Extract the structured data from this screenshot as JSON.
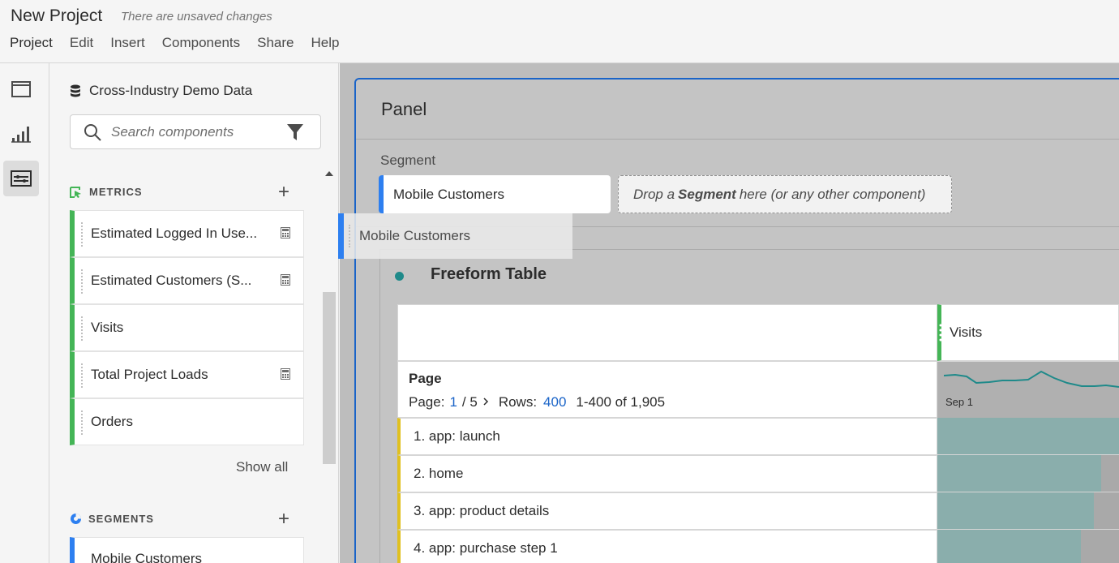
{
  "header": {
    "title": "New Project",
    "status": "There are unsaved changes",
    "menu": [
      "Project",
      "Edit",
      "Insert",
      "Components",
      "Share",
      "Help"
    ]
  },
  "rail": {
    "items": [
      "panels-icon",
      "visualizations-icon",
      "components-icon"
    ],
    "active": "components-icon"
  },
  "left_panel": {
    "report_suite": "Cross-Industry Demo Data",
    "search": {
      "placeholder": "Search components",
      "value": ""
    },
    "metrics": {
      "header": "METRICS",
      "items": [
        {
          "label": "Estimated Logged In Use...",
          "calculated": true
        },
        {
          "label": "Estimated Customers (S...",
          "calculated": true
        },
        {
          "label": "Visits",
          "calculated": false
        },
        {
          "label": "Total Project Loads",
          "calculated": true
        },
        {
          "label": "Orders",
          "calculated": false
        }
      ],
      "show_all": "Show all"
    },
    "segments": {
      "header": "SEGMENTS",
      "items": [
        "Mobile Customers"
      ]
    }
  },
  "panel": {
    "title": "Panel",
    "segment_label": "Segment",
    "segment_chip": "Mobile Customers",
    "drop_zone": {
      "prefix": "Drop a",
      "bold": "Segment",
      "suffix": "here (or any other component)"
    },
    "drag_ghost": "Mobile Customers",
    "visualization": {
      "title": "Freeform Table",
      "metric_column": "Visits",
      "dimension": "Page",
      "paging": {
        "page_label": "Page:",
        "page": "1",
        "of": "/ 5",
        "rows_label": "Rows:",
        "rows": "400",
        "range": "1-400 of 1,905"
      },
      "sparkline_label": "Sep 1",
      "rows": [
        {
          "label": "1. app: launch",
          "fill": 1.0
        },
        {
          "label": "2. home",
          "fill": 0.9
        },
        {
          "label": "3. app: product details",
          "fill": 0.86
        },
        {
          "label": "4. app: purchase step 1",
          "fill": 0.79
        }
      ]
    }
  },
  "colors": {
    "metric_accent": "#44b556",
    "segment_accent": "#2d7ff0",
    "dimension_accent": "#e0c020",
    "selection": "#1a64c8",
    "bar": "#8aaeac"
  }
}
